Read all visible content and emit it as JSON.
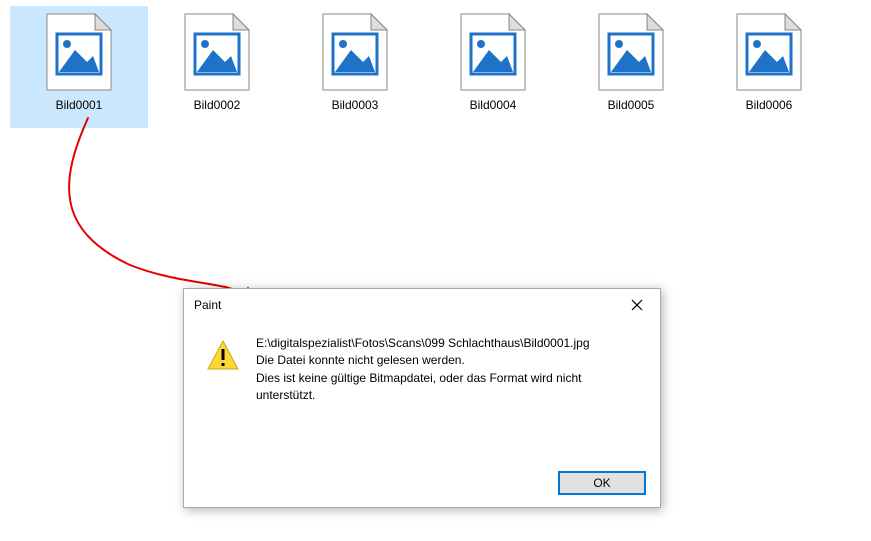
{
  "files": [
    {
      "name": "Bild0001",
      "selected": true
    },
    {
      "name": "Bild0002",
      "selected": false
    },
    {
      "name": "Bild0003",
      "selected": false
    },
    {
      "name": "Bild0004",
      "selected": false
    },
    {
      "name": "Bild0005",
      "selected": false
    },
    {
      "name": "Bild0006",
      "selected": false
    }
  ],
  "dialog": {
    "title": "Paint",
    "line1": "E:\\digitalspezialist\\Fotos\\Scans\\099 Schlachthaus\\Bild0001.jpg",
    "line2": "Die Datei konnte nicht gelesen werden.",
    "line3": "Dies ist keine gültige Bitmapdatei, oder das Format wird nicht unterstützt.",
    "ok_label": "OK"
  },
  "colors": {
    "selection": "#cce8ff",
    "icon_blue": "#1e73c8",
    "annotation_red": "#e60000",
    "ok_border": "#0078d7",
    "warning_yellow": "#fdd835"
  }
}
